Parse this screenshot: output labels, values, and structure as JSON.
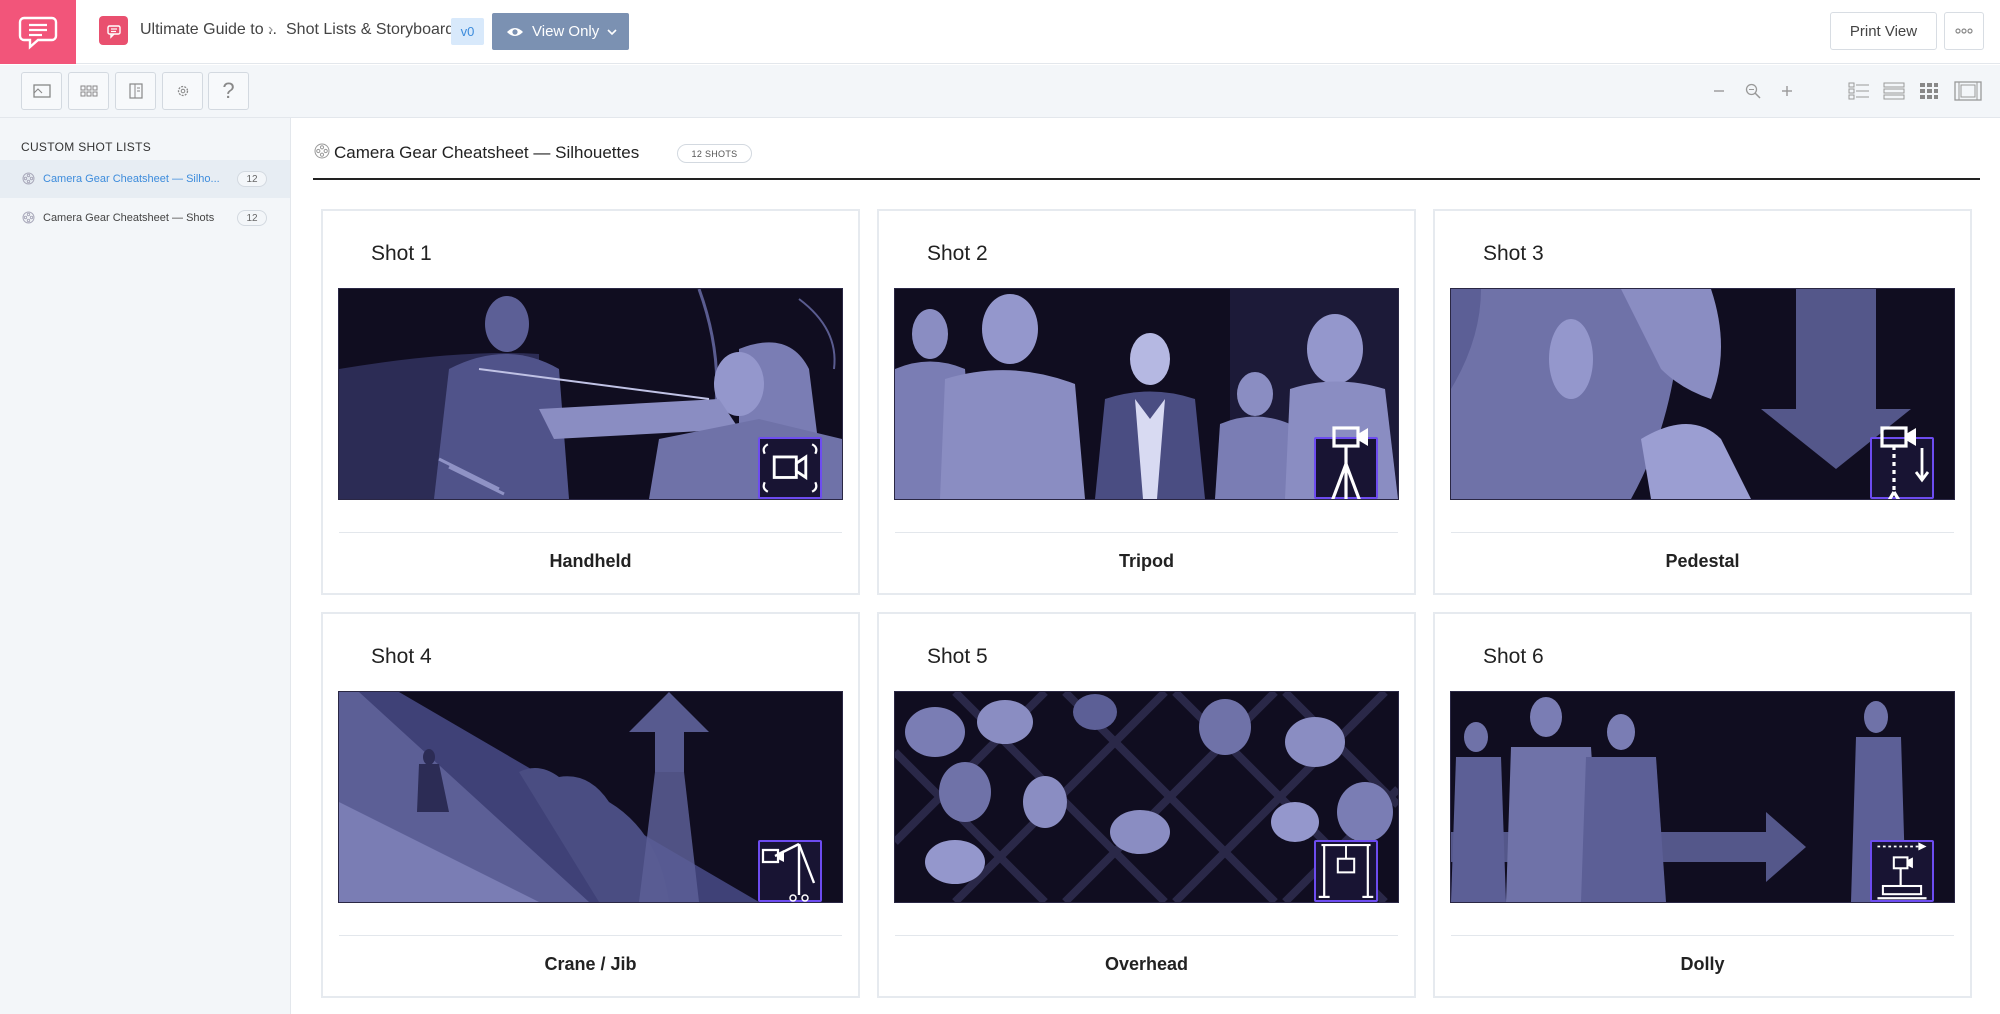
{
  "header": {
    "crumb_project": "Ultimate Guide to ..",
    "crumb_section": "Shot Lists & Storyboards",
    "version": "v0",
    "view_mode": "View Only",
    "print_view": "Print View"
  },
  "sidebar": {
    "heading": "CUSTOM SHOT LISTS",
    "items": [
      {
        "label": "Camera Gear Cheatsheet — Silho...",
        "count": "12",
        "active": true
      },
      {
        "label": "Camera Gear Cheatsheet — Shots",
        "count": "12",
        "active": false
      }
    ]
  },
  "main": {
    "title": "Camera Gear Cheatsheet — Silhouettes",
    "shots_badge": "12 SHOTS"
  },
  "shots": [
    {
      "title": "Shot 1",
      "gear": "Handheld",
      "icon": "handheld-camera-icon"
    },
    {
      "title": "Shot 2",
      "gear": "Tripod",
      "icon": "tripod-icon"
    },
    {
      "title": "Shot 3",
      "gear": "Pedestal",
      "icon": "pedestal-icon"
    },
    {
      "title": "Shot 4",
      "gear": "Crane / Jib",
      "icon": "crane-jib-icon"
    },
    {
      "title": "Shot 5",
      "gear": "Overhead",
      "icon": "overhead-rig-icon"
    },
    {
      "title": "Shot 6",
      "gear": "Dolly",
      "icon": "dolly-icon"
    }
  ],
  "colors": {
    "brand": "#f2557a",
    "view_only": "#7b91b2",
    "active_link": "#3d8cdc",
    "frame_bg": "#120f22",
    "silhouette": "#6f72a8",
    "icon_border": "#6d4cf0"
  }
}
